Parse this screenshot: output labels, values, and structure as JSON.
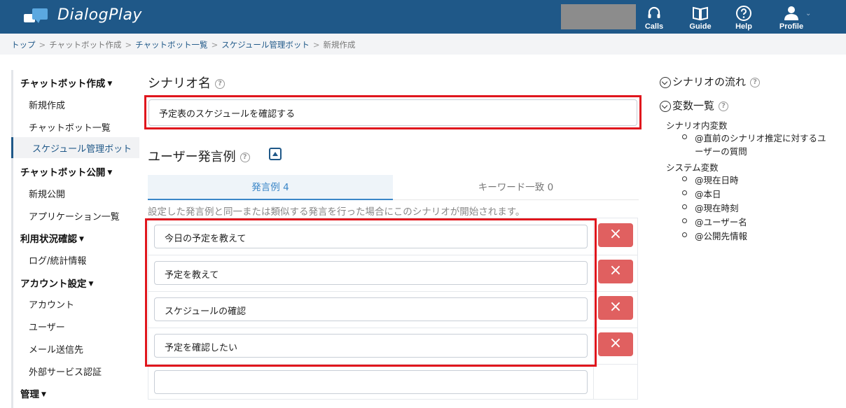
{
  "header": {
    "brand": "DialogPlay",
    "nav": [
      {
        "label": "Calls",
        "icon": "headset-icon"
      },
      {
        "label": "Guide",
        "icon": "book-icon"
      },
      {
        "label": "Help",
        "icon": "question-icon"
      },
      {
        "label": "Profile",
        "icon": "user-icon"
      }
    ]
  },
  "breadcrumb": {
    "items": [
      "トップ",
      "チャットボット作成",
      "チャットボット一覧",
      "スケジュール管理ボット"
    ],
    "current": "新規作成",
    "separator": ">"
  },
  "sidebar": {
    "groups": [
      {
        "label": "チャットボット作成",
        "items": [
          "新規作成",
          "チャットボット一覧",
          "スケジュール管理ボット"
        ]
      },
      {
        "label": "チャットボット公開",
        "items": [
          "新規公開",
          "アプリケーション一覧"
        ]
      },
      {
        "label": "利用状況確認",
        "items": [
          "ログ/統計情報"
        ]
      },
      {
        "label": "アカウント設定",
        "items": [
          "アカウント",
          "ユーザー",
          "メール送信先",
          "外部サービス認証"
        ]
      },
      {
        "label": "管理",
        "items": []
      }
    ],
    "active_item": "スケジュール管理ボット"
  },
  "scenario": {
    "title": "シナリオ名",
    "help": "?",
    "value": "予定表のスケジュールを確認する"
  },
  "utterances": {
    "title": "ユーザー発言例",
    "help": "?",
    "tabs": [
      {
        "label": "発言例 4",
        "active": true
      },
      {
        "label": "キーワード一致 0",
        "active": false
      }
    ],
    "description": "設定した発言例と同一または類似する発言を行った場合にこのシナリオが開始されます。",
    "items": [
      "今日の予定を教えて",
      "予定を教えて",
      "スケジュールの確認",
      "予定を確認したい"
    ],
    "new_value": "",
    "delete_label": "×"
  },
  "right_panel": {
    "flow_title": "シナリオの流れ",
    "vars_title": "変数一覧",
    "help": "?",
    "sections": [
      {
        "label": "シナリオ内変数",
        "items": [
          "@直前のシナリオ推定に対するユーザーの質問"
        ]
      },
      {
        "label": "システム変数",
        "items": [
          "@現在日時",
          "@本日",
          "@現在時刻",
          "@ユーザー名",
          "@公開先情報"
        ]
      }
    ]
  },
  "colors": {
    "header_bg": "#1f5888",
    "highlight_border": "#e0161d",
    "delete_button": "#e06060",
    "tab_active": "#3a86c8"
  }
}
